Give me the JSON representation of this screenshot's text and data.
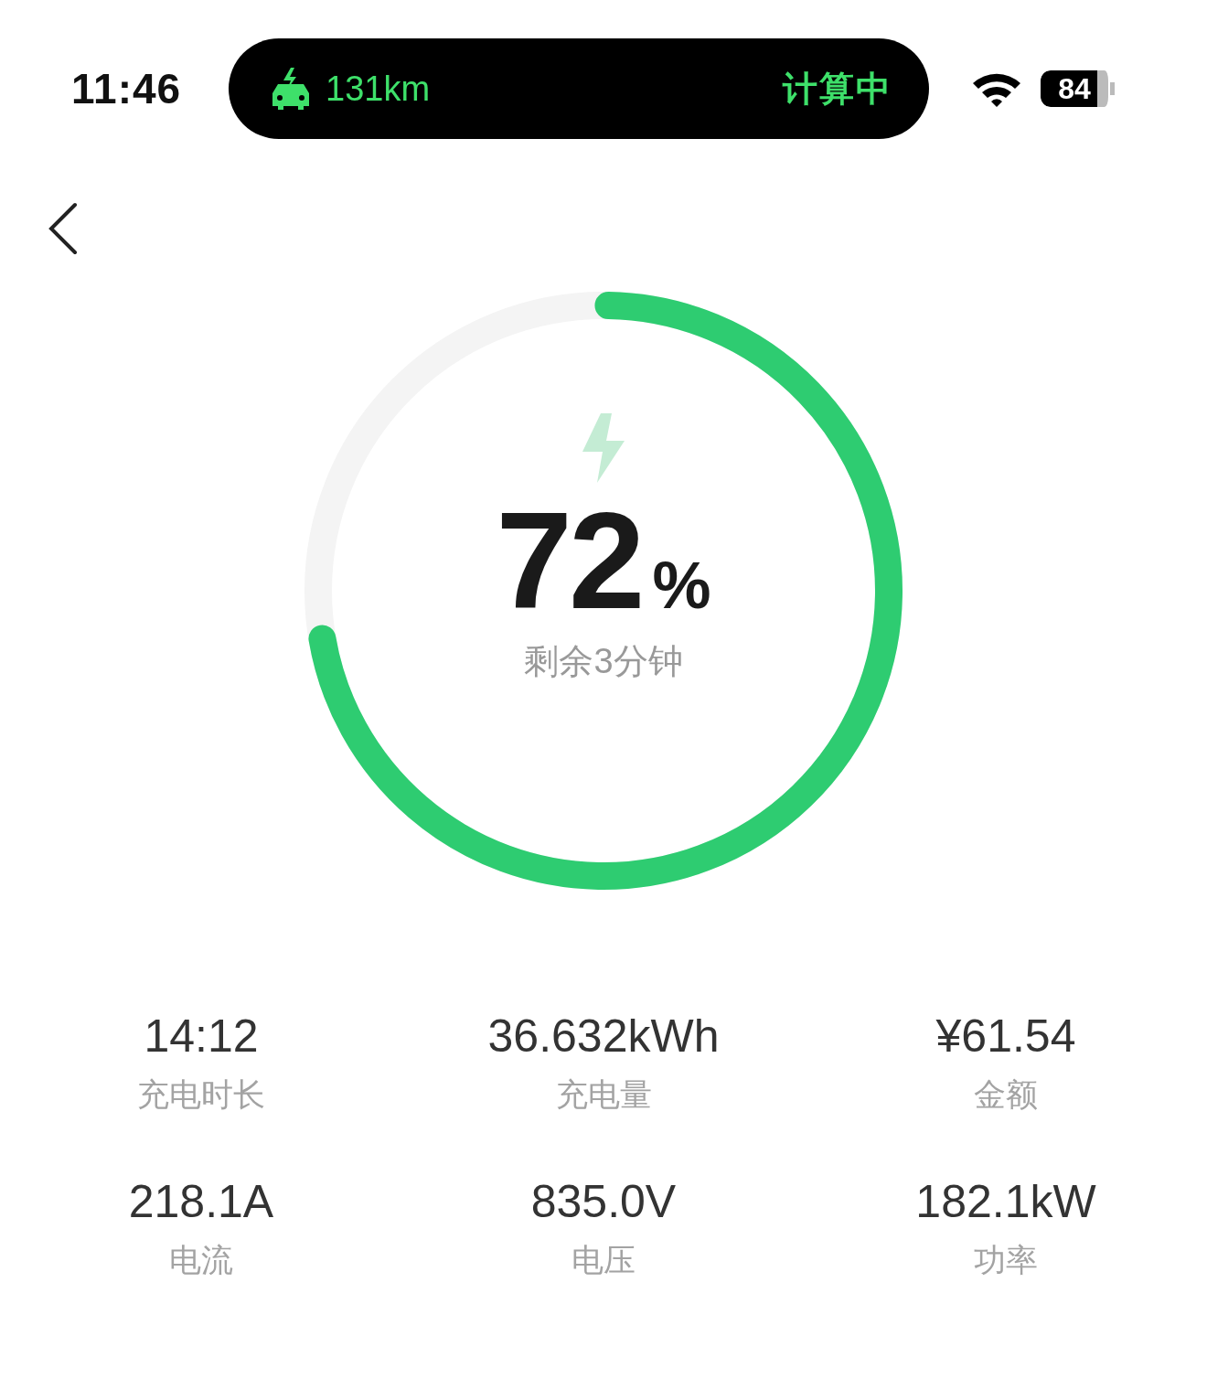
{
  "status_bar": {
    "time": "11:46",
    "island": {
      "range": "131km",
      "status": "计算中"
    },
    "battery": "84"
  },
  "charge": {
    "percent": "72",
    "unit": "%",
    "remaining": "剩余3分钟"
  },
  "stats": [
    {
      "value": "14:12",
      "label": "充电时长"
    },
    {
      "value": "36.632kWh",
      "label": "充电量"
    },
    {
      "value": "¥61.54",
      "label": "金额"
    },
    {
      "value": "218.1A",
      "label": "电流"
    },
    {
      "value": "835.0V",
      "label": "电压"
    },
    {
      "value": "182.1kW",
      "label": "功率"
    }
  ]
}
